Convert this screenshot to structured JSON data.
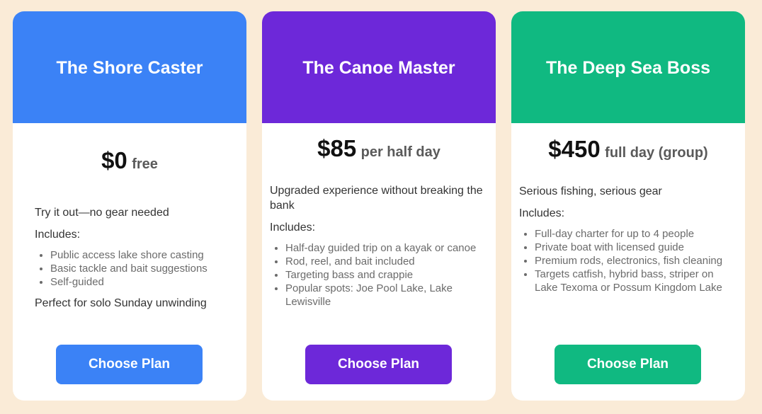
{
  "plans": [
    {
      "title": "The Shore Caster",
      "price": "$0",
      "period": "free",
      "description": "Try it out—no gear needed",
      "includes_label": "Includes:",
      "features": [
        "Public access lake shore casting",
        "Basic tackle and bait suggestions",
        "Self-guided"
      ],
      "note": "Perfect for solo Sunday unwinding",
      "button_label": "Choose Plan",
      "color": "#3b82f6"
    },
    {
      "title": "The Canoe Master",
      "price": "$85",
      "period": "per half day",
      "description": "Upgraded experience without breaking the bank",
      "includes_label": "Includes:",
      "features": [
        "Half-day guided trip on a kayak or canoe",
        "Rod, reel, and bait included",
        "Targeting bass and crappie",
        "Popular spots: Joe Pool Lake, Lake Lewisville"
      ],
      "button_label": "Choose Plan",
      "color": "#6d28d9"
    },
    {
      "title": "The Deep Sea Boss",
      "price": "$450",
      "period": "full day (group)",
      "description": "Serious fishing, serious gear",
      "includes_label": "Includes:",
      "features": [
        "Full-day charter for up to 4 people",
        "Private boat with licensed guide",
        "Premium rods, electronics, fish cleaning",
        "Targets catfish, hybrid bass, striper on Lake Texoma or Possum Kingdom Lake"
      ],
      "button_label": "Choose Plan",
      "color": "#10b981"
    }
  ]
}
